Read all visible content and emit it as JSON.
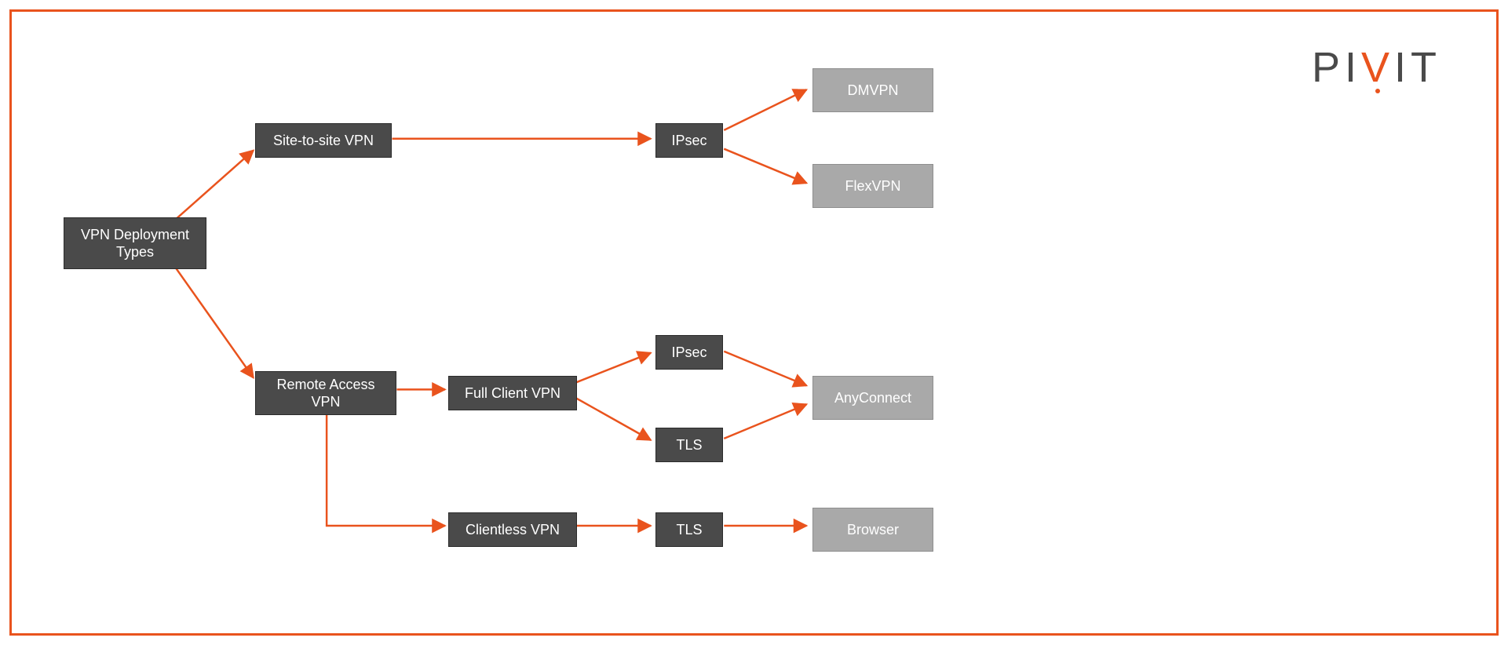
{
  "brand": {
    "text_grey_1": "PI",
    "text_orange": "V",
    "text_grey_2": "IT"
  },
  "colors": {
    "accent": "#e9531d",
    "node_dark": "#4a4a4a",
    "node_light": "#a9a9a9"
  },
  "nodes": {
    "root": {
      "label": "VPN Deployment Types"
    },
    "site": {
      "label": "Site-to-site VPN"
    },
    "ipsec_s": {
      "label": "IPsec"
    },
    "dmvpn": {
      "label": "DMVPN"
    },
    "flexvpn": {
      "label": "FlexVPN"
    },
    "remote": {
      "label": "Remote Access VPN"
    },
    "fullclient": {
      "label": "Full Client VPN"
    },
    "ipsec_r": {
      "label": "IPsec"
    },
    "tls_r": {
      "label": "TLS"
    },
    "anyconnect": {
      "label": "AnyConnect"
    },
    "clientless": {
      "label": "Clientless VPN"
    },
    "tls_c": {
      "label": "TLS"
    },
    "browser": {
      "label": "Browser"
    }
  }
}
